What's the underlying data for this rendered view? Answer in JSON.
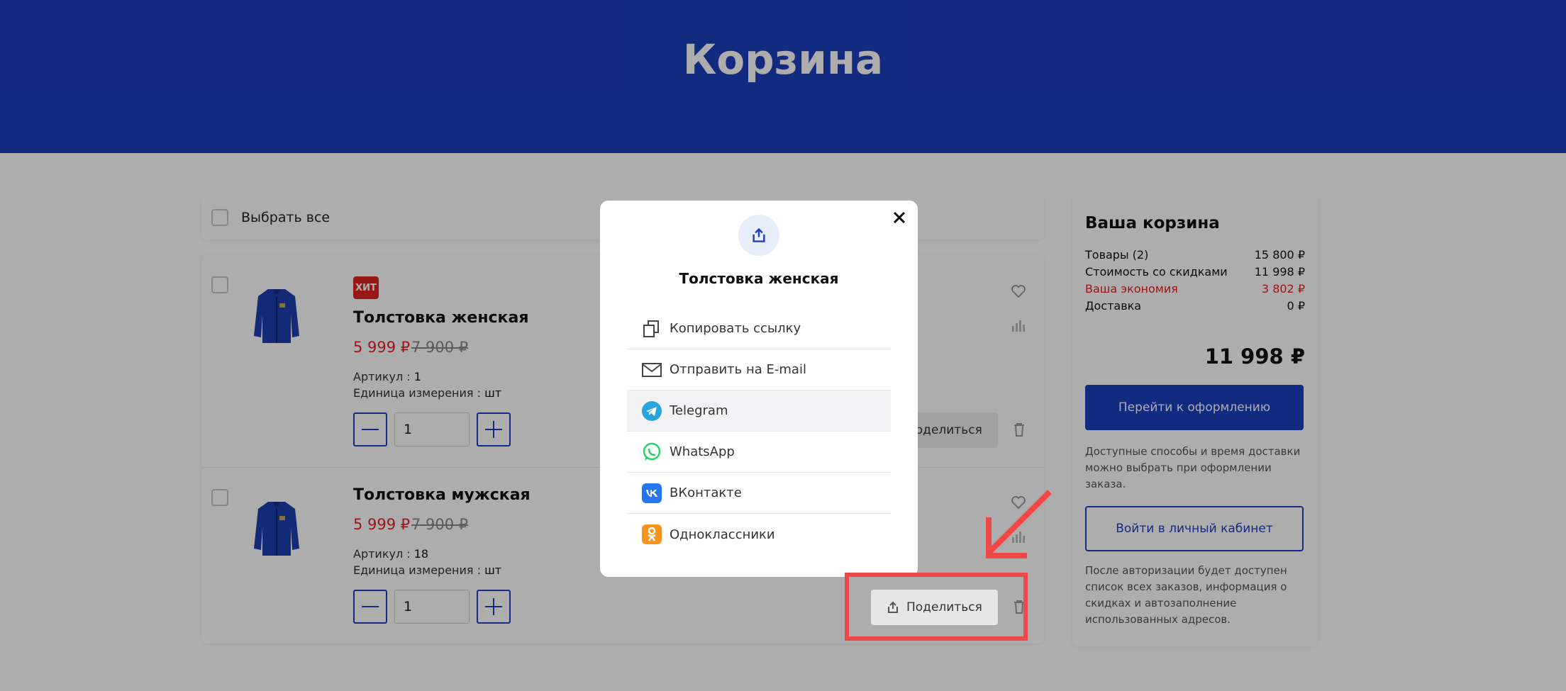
{
  "page": {
    "title": "Корзина"
  },
  "colors": {
    "brand": "#1d3ebf",
    "price_red": "#e02424",
    "annotation": "#f04848"
  },
  "cart": {
    "select_all_label": "Выбрать все",
    "items": [
      {
        "badge": "ХИТ",
        "name": "Толстовка женская",
        "price_new": "5 999 ₽",
        "price_old": "7 900 ₽",
        "sku_label": "Артикул",
        "sku_value": "1",
        "unit_label": "Единица измерения",
        "unit_value": "шт",
        "quantity": "1",
        "share_label": "Поделиться"
      },
      {
        "badge": "",
        "name": "Толстовка мужская",
        "price_new": "5 999 ₽",
        "price_old": "7 900 ₽",
        "sku_label": "Артикул",
        "sku_value": "18",
        "unit_label": "Единица измерения",
        "unit_value": "шт",
        "quantity": "1",
        "share_label": "Поделиться"
      }
    ]
  },
  "summary": {
    "title": "Ваша корзина",
    "rows": [
      {
        "label": "Товары (2)",
        "value": "15 800 ₽"
      },
      {
        "label": "Стоимость со скидками",
        "value": "11 998 ₽"
      },
      {
        "label": "Ваша экономия",
        "value": "3 802 ₽"
      },
      {
        "label": "Доставка",
        "value": "0 ₽"
      }
    ],
    "total": "11 998 ₽",
    "checkout_button": "Перейти к оформлению",
    "delivery_note": "Доступные способы и время доставки можно выбрать при оформлении заказа.",
    "login_button": "Войти в личный кабинет",
    "login_note": "После авторизации будет доступен список всех заказов, информация о скидках и автозаполнение использованных адресов."
  },
  "share_modal": {
    "title": "Толстовка женская",
    "options": [
      {
        "label": "Копировать ссылку",
        "icon": "copy-icon"
      },
      {
        "label": "Отправить на E-mail",
        "icon": "mail-icon"
      },
      {
        "label": "Telegram",
        "icon": "telegram-icon"
      },
      {
        "label": "WhatsApp",
        "icon": "whatsapp-icon"
      },
      {
        "label": "ВКонтакте",
        "icon": "vk-icon"
      },
      {
        "label": "Одноклассники",
        "icon": "ok-icon"
      }
    ]
  }
}
